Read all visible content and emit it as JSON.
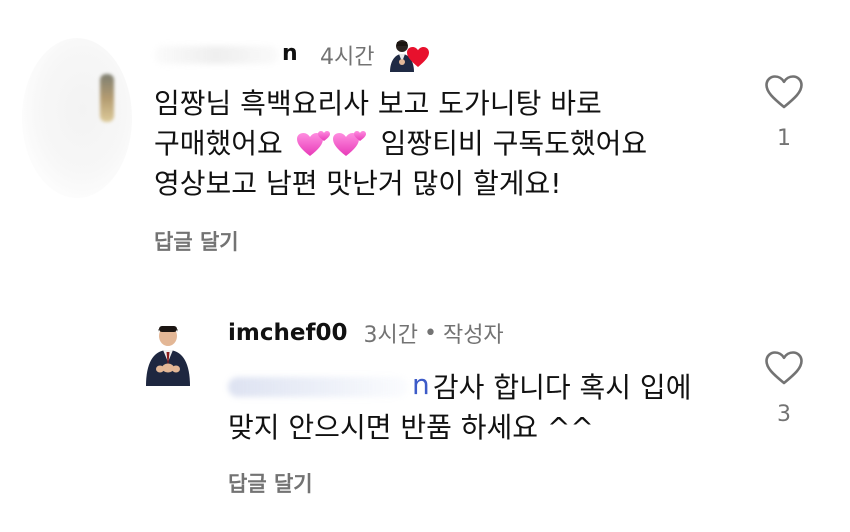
{
  "comments": [
    {
      "username_visible_tail": "n",
      "time": "4시간",
      "text_line1": "임짱님 흑백요리사 보고 도가니탕 바로",
      "text_line2_a": "구매했어요",
      "text_line2_b": "임짱티비 구독도했어요",
      "text_line3": "영상보고 남편 맛난거 많이 할게요!",
      "reply_label": "답글 달기",
      "like_count": "1"
    },
    {
      "username": "imchef00",
      "time": "3시간",
      "separator": "•",
      "author_label": "작성자",
      "mention_visible_tail": "n",
      "text_line1": "감사 합니다 혹시 입에",
      "text_line2": "맞지 안으시면 반품 하세요 ^^",
      "reply_label": "답글 달기",
      "like_count": "3"
    }
  ],
  "icons": {
    "like": "heart-outline-icon",
    "liked_by_author": "red-heart-icon",
    "emoji": "two-pink-hearts-emoji"
  },
  "colors": {
    "text": "#111111",
    "secondary": "#737373",
    "mention": "#3d5bc8",
    "liked_heart": "#e8112d",
    "emoji_pink": "#ff5fc8"
  }
}
